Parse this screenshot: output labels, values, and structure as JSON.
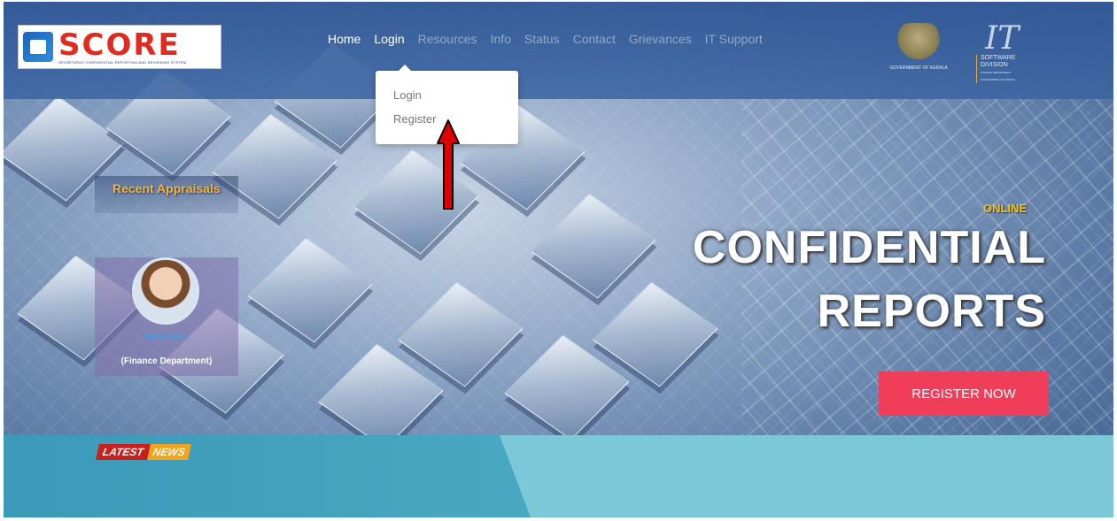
{
  "logo": {
    "name": "SCORE",
    "subtitle": "SECRETARIAT CONFIDENTIAL REPORTING AND REVIEWING SYSTEM"
  },
  "nav": {
    "items": [
      {
        "label": "Home"
      },
      {
        "label": "Login"
      },
      {
        "label": "Resources"
      },
      {
        "label": "Info"
      },
      {
        "label": "Status"
      },
      {
        "label": "Contact"
      },
      {
        "label": "Grievances"
      },
      {
        "label": "IT Support"
      }
    ]
  },
  "login_dropdown": {
    "items": [
      {
        "label": "Login"
      },
      {
        "label": "Register"
      }
    ]
  },
  "emblem": {
    "caption": "GOVERNMENT OF KERALA"
  },
  "it_logo": {
    "mark": "IT",
    "line1": "SOFTWARE",
    "line2": "DIVISION",
    "line3": "FINANCE DEPARTMENT",
    "line4": "GOVERNMENT OF KERALA"
  },
  "appraisals": {
    "title": "Recent Appraisals",
    "employee_name": "PRIYA M R",
    "department": "(Finance Department)"
  },
  "hero": {
    "tag": "ONLINE",
    "title_line1": "CONFIDENTIAL",
    "title_line2": "REPORTS",
    "cta": "REGISTER NOW"
  },
  "news": {
    "part1": "LATEST",
    "part2": "NEWS"
  },
  "colors": {
    "header": "#3a64a2",
    "cta": "#f03d5a",
    "online": "#f3c316",
    "appraisal_title": "#f2b43a",
    "news_red": "#c8201e",
    "news_orange": "#f3a21a",
    "arrow": "#e00000"
  }
}
